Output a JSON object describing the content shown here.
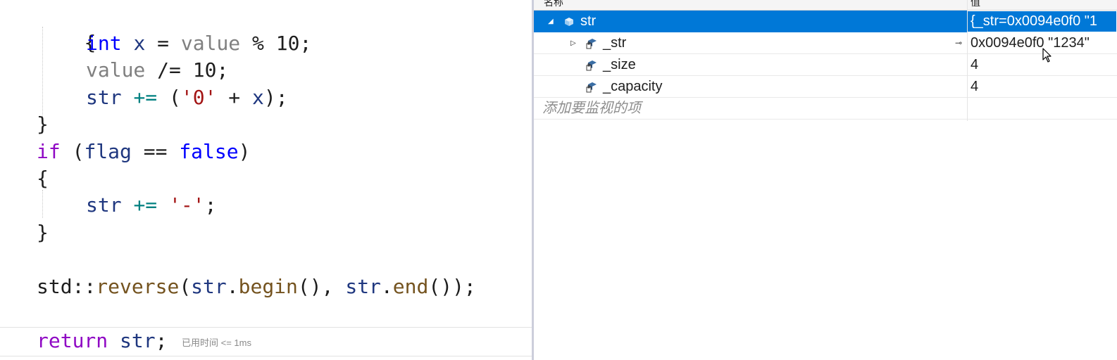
{
  "editor": {
    "lines": {
      "open_brace_1": "{",
      "int_kw": "int",
      "x_var": "x",
      "assign": " = ",
      "value_1": "value",
      "mod_10": " % 10;",
      "value_2": "value",
      "div_assign": " /= 10;",
      "str_1": "str",
      "plus_assign_1": "+=",
      "paren_open": " (",
      "char_zero": "'0'",
      "plus_x": " + ",
      "x_var_2": "x",
      "paren_close": ");",
      "close_brace_1": "}",
      "if_kw": "if",
      "if_cond_open": " (",
      "flag": "flag",
      "eq": " == ",
      "false_kw": "false",
      "if_cond_close": ")",
      "open_brace_2": "{",
      "str_2": "str",
      "plus_assign_2": "+=",
      "char_minus": "'-'",
      "semicolon": ";",
      "close_brace_2": "}",
      "std_ns": "std::",
      "reverse_fn": "reverse",
      "rev_paren": "(",
      "str_3": "str",
      "dot_1": ".",
      "begin_fn": "begin",
      "begin_args": "(), ",
      "str_4": "str",
      "dot_2": ".",
      "end_fn": "end",
      "end_args": "());",
      "return_kw": "return",
      "str_5": "str",
      "return_semicolon": ";"
    },
    "perf_tip": "已用时间 <= 1ms"
  },
  "watch": {
    "headers": {
      "name": "名称",
      "value": "值"
    },
    "rows": [
      {
        "name": "str",
        "value": "{_str=0x0094e0f0 \"1",
        "expander": "◢",
        "icon": "object-icon",
        "selected": true
      },
      {
        "name": "_str",
        "value": "0x0094e0f0 \"1234\"",
        "expander": "▷",
        "icon": "field-icon",
        "pin": "⊸"
      },
      {
        "name": "_size",
        "value": "4",
        "icon": "field-icon"
      },
      {
        "name": "_capacity",
        "value": "4",
        "icon": "field-icon"
      }
    ],
    "add_item_placeholder": "添加要监视的项"
  },
  "colors": {
    "selection": "#0078d7",
    "keyword": "#0000ff",
    "control_keyword": "#8f08c4",
    "identifier": "#1f377f",
    "string_literal": "#a31515",
    "function": "#74531f"
  }
}
